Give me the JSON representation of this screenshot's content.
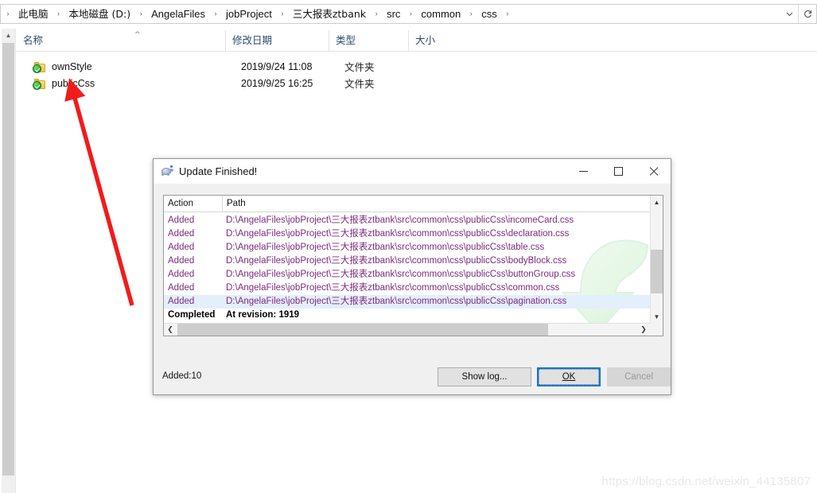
{
  "explorer": {
    "breadcrumb": {
      "items": [
        {
          "label": "此电脑"
        },
        {
          "label": "本地磁盘 (D:)"
        },
        {
          "label": "AngelaFiles"
        },
        {
          "label": "jobProject"
        },
        {
          "label": "三大报表ztbank"
        },
        {
          "label": "src"
        },
        {
          "label": "common"
        },
        {
          "label": "css"
        }
      ],
      "separator": "›",
      "dropdown_icon": "chevron-down-icon",
      "refresh_icon": "refresh-icon"
    },
    "columns": [
      {
        "label": "名称",
        "key": "name"
      },
      {
        "label": "修改日期",
        "key": "date"
      },
      {
        "label": "类型",
        "key": "type"
      },
      {
        "label": "大小",
        "key": "size"
      }
    ],
    "sort_indicator": "^",
    "rows": [
      {
        "name": "ownStyle",
        "date": "2019/9/24 11:08",
        "type": "文件夹",
        "size": "",
        "icon": "folder-svn-normal-icon"
      },
      {
        "name": "publicCss",
        "date": "2019/9/25 16:25",
        "type": "文件夹",
        "size": "",
        "icon": "folder-svn-normal-icon"
      }
    ],
    "annotation": {
      "type": "red-arrow",
      "points_to": "publicCss"
    },
    "watermark": "https://blog.csdn.net/weixin_44135807"
  },
  "dialog": {
    "title": "Update Finished!",
    "app_icon": "tortoisesvn-turtle-icon",
    "window_controls": [
      {
        "name": "minimize",
        "glyph": "minimize-icon"
      },
      {
        "name": "maximize",
        "glyph": "maximize-icon"
      },
      {
        "name": "close",
        "glyph": "close-icon"
      }
    ],
    "list": {
      "headers": [
        {
          "label": "Action",
          "key": "action"
        },
        {
          "label": "Path",
          "key": "path"
        }
      ],
      "rows": [
        {
          "action": "Added",
          "path": "D:\\AngelaFiles\\jobProject\\三大报表ztbank\\src\\common\\css\\publicCss\\incomeCard.css",
          "selected": false,
          "done": false
        },
        {
          "action": "Added",
          "path": "D:\\AngelaFiles\\jobProject\\三大报表ztbank\\src\\common\\css\\publicCss\\declaration.css",
          "selected": false,
          "done": false
        },
        {
          "action": "Added",
          "path": "D:\\AngelaFiles\\jobProject\\三大报表ztbank\\src\\common\\css\\publicCss\\table.css",
          "selected": false,
          "done": false
        },
        {
          "action": "Added",
          "path": "D:\\AngelaFiles\\jobProject\\三大报表ztbank\\src\\common\\css\\publicCss\\bodyBlock.css",
          "selected": false,
          "done": false
        },
        {
          "action": "Added",
          "path": "D:\\AngelaFiles\\jobProject\\三大报表ztbank\\src\\common\\css\\publicCss\\buttonGroup.css",
          "selected": false,
          "done": false
        },
        {
          "action": "Added",
          "path": "D:\\AngelaFiles\\jobProject\\三大报表ztbank\\src\\common\\css\\publicCss\\common.css",
          "selected": false,
          "done": false
        },
        {
          "action": "Added",
          "path": "D:\\AngelaFiles\\jobProject\\三大报表ztbank\\src\\common\\css\\publicCss\\pagination.css",
          "selected": true,
          "done": false
        },
        {
          "action": "Completed",
          "path": "At revision: 1919",
          "selected": false,
          "done": true
        }
      ],
      "watermark_icon": "green-update-arrow-icon",
      "vscrollbar": {
        "up": "▲",
        "down": "▼"
      },
      "hscrollbar": {
        "left": "❮",
        "right": "❯"
      }
    },
    "status": "Added:10",
    "buttons": [
      {
        "label": "Show log...",
        "name": "show-log-button",
        "state": "enabled"
      },
      {
        "label": "OK",
        "name": "ok-button",
        "state": "focused"
      },
      {
        "label": "Cancel",
        "name": "cancel-button",
        "state": "disabled"
      }
    ]
  }
}
